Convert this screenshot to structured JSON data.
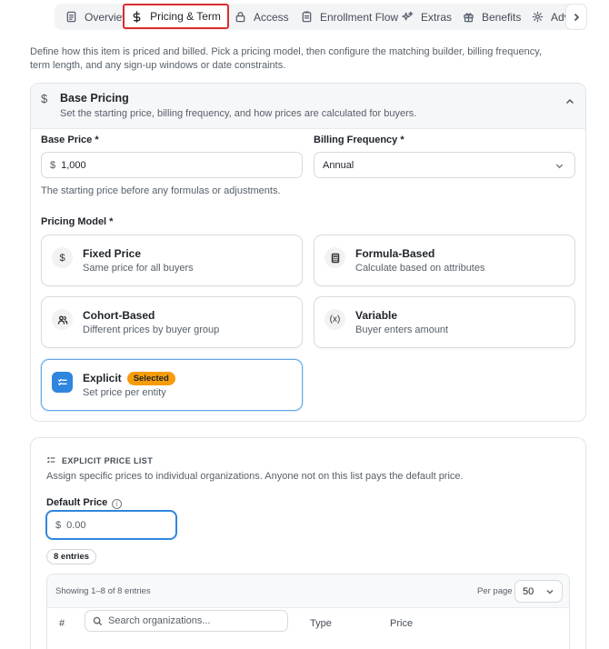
{
  "tabs": {
    "items": [
      {
        "label": "Overview",
        "icon": "document-icon"
      },
      {
        "label": "Pricing & Term",
        "icon": "dollar-icon",
        "active": true
      },
      {
        "label": "Access",
        "icon": "lock-icon"
      },
      {
        "label": "Enrollment Flow",
        "icon": "clipboard-icon"
      },
      {
        "label": "Extras",
        "icon": "sparkles-icon"
      },
      {
        "label": "Benefits",
        "icon": "gift-icon"
      },
      {
        "label": "Adv",
        "icon": "gear-icon"
      }
    ],
    "active_color": "#d92d2d"
  },
  "description": "Define how this item is priced and billed. Pick a pricing model, then configure the matching builder, billing frequency, term length, and any sign-up windows or date constraints.",
  "base_pricing": {
    "icon_glyph": "$",
    "title": "Base Pricing",
    "subtitle": "Set the starting price, billing frequency, and how prices are calculated for buyers.",
    "base_price_label": "Base Price *",
    "currency_symbol": "$",
    "base_price_value": "1,000",
    "base_price_help": "The starting price before any formulas or adjustments.",
    "billing_label": "Billing Frequency *",
    "billing_value": "Annual",
    "model_label": "Pricing Model *",
    "models": [
      {
        "title": "Fixed Price",
        "subtitle": "Same price for all buyers",
        "icon": "dollar-icon",
        "icon_glyph": "$"
      },
      {
        "title": "Formula-Based",
        "subtitle": "Calculate based on attributes",
        "icon": "calculator-icon"
      },
      {
        "title": "Cohort-Based",
        "subtitle": "Different prices by buyer group",
        "icon": "users-icon"
      },
      {
        "title": "Variable",
        "subtitle": "Buyer enters amount",
        "icon": "variable-icon",
        "icon_glyph": "(x)"
      },
      {
        "title": "Explicit",
        "subtitle": "Set price per entity",
        "icon": "checklist-icon",
        "selected": true,
        "badge": "Selected"
      }
    ],
    "badge_color": "#f59c0b",
    "selected_color": "#2f86de"
  },
  "explicit_list": {
    "title": "EXPLICIT PRICE LIST",
    "subtitle": "Assign specific prices to individual organizations. Anyone not on this list pays the default price.",
    "default_price_label": "Default Price",
    "info_glyph": "i",
    "currency_symbol": "$",
    "default_price_placeholder": "0.00",
    "entries_badge": "8 entries",
    "showing": "Showing 1–8 of 8 entries",
    "per_page_label": "Per page",
    "per_page_value": "50",
    "columns": {
      "num": "#",
      "type": "Type",
      "price": "Price"
    },
    "search_placeholder": "Search organizations..."
  }
}
